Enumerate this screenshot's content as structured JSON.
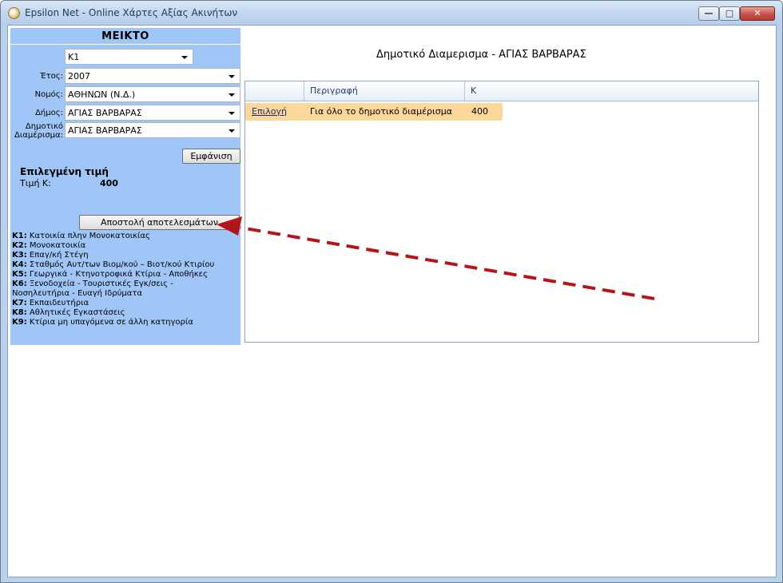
{
  "window": {
    "title": "Epsilon Net - Online Χάρτες Αξίας Ακινήτων",
    "min_glyph": "—",
    "max_glyph": "□",
    "close_glyph": "✕"
  },
  "panel": {
    "header": "ΜΕΙΚΤΟ",
    "category_value": "Κ1",
    "fields": [
      {
        "label": "Έτος:",
        "value": "2007"
      },
      {
        "label": "Νομός:",
        "value": "ΑΘΗΝΩΝ (Ν.Δ.)"
      },
      {
        "label": "Δήμος:",
        "value": "ΑΓΙΑΣ ΒΑΡΒΑΡΑΣ"
      },
      {
        "label_line1": "Δημοτικό",
        "label_line2": "Διαμέρισμα:",
        "value": "ΑΓΙΑΣ ΒΑΡΒΑΡΑΣ"
      }
    ],
    "show_button": "Εμφάνιση",
    "selected_title": "Επιλεγμένη τιμή",
    "selected_label": "Τιμή Κ:",
    "selected_value": "400",
    "send_button": "Αποστολή αποτελεσμάτων"
  },
  "legend": [
    {
      "code": "Κ1:",
      "text": " Κατοικία πλην Μονοκατοικίας"
    },
    {
      "code": "Κ2:",
      "text": " Μονοκατοικία"
    },
    {
      "code": "Κ3:",
      "text": " Επαγ/κή Στέγη"
    },
    {
      "code": "Κ4:",
      "text": " Σταθμός Αυτ/των Βιομ/κού – Βιοτ/κού Κτιρίου"
    },
    {
      "code": "Κ5:",
      "text": " Γεωργικά - Κτηνοτροφικά Κτίρια - Αποθήκες"
    },
    {
      "code": "Κ6:",
      "text": " Ξενοδοχεία - Τουριστικές Εγκ/σεις -"
    },
    {
      "code": "",
      "text": "Νοσηλευτήρια - Ευαγή Ιδρύματα"
    },
    {
      "code": "Κ7:",
      "text": " Εκπαιδευτήρια"
    },
    {
      "code": "Κ8:",
      "text": " Αθλητικές Εγκαστάσεις"
    },
    {
      "code": "Κ9:",
      "text": " Κτίρια μη υπαγόμενα σε άλλη κατηγορία"
    }
  ],
  "main": {
    "area_title": "Δημοτικό Διαμερισμα - ΑΓΙΑΣ ΒΑΡΒΑΡΑΣ",
    "columns": [
      "",
      "Περιγραφή",
      "Κ"
    ],
    "rows": [
      {
        "action": "Επιλογή",
        "description": "Για όλο το δημοτικό διαμέρισμα",
        "k": "400"
      }
    ]
  },
  "colors": {
    "panel_bg": "#9fc6f6",
    "row_highlight": "#fcd79a",
    "arrow": "#b3151b"
  }
}
